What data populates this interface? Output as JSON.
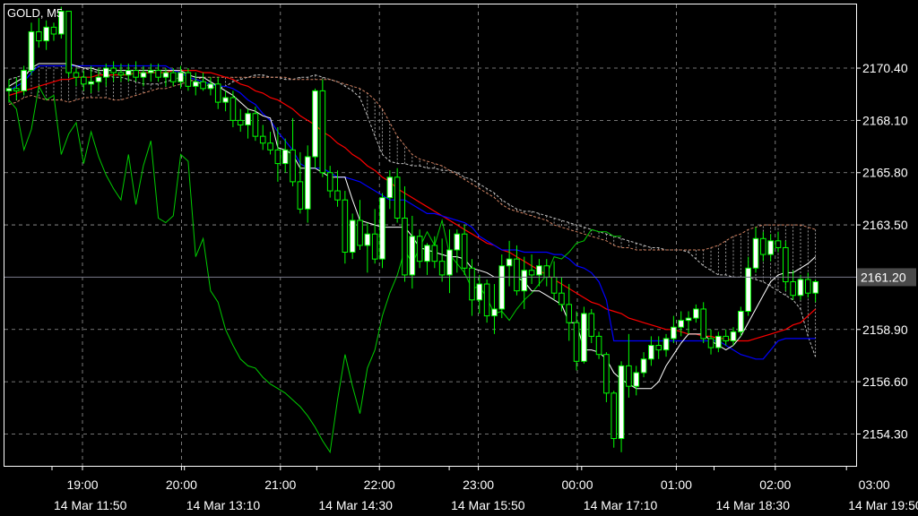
{
  "header": {
    "title": "GOLD, M5"
  },
  "chart_data": {
    "type": "candlestick",
    "symbol": "GOLD",
    "timeframe": "M5",
    "grid": true,
    "colors": {
      "background": "#000000",
      "grid": "#9a9a9a",
      "candle": "#00ff00",
      "bull_body": "#ffffff",
      "tenkan_sen": "#ffffff",
      "kijun_sen": "#0000ff",
      "moving_average": "#ff0000",
      "chikou_span": "#00cc00",
      "cloud_edge_a": "#c0c0c0",
      "cloud_edge_b": "#d08060",
      "current_price_line": "#7a7a8a",
      "price_tag_bg": "#4a4a4a"
    },
    "y_axis": {
      "min": 2152.9,
      "max": 2173.2,
      "ticks": [
        "2170.40",
        "2168.10",
        "2165.80",
        "2163.50",
        "2158.90",
        "2156.60",
        "2154.30"
      ]
    },
    "current_price": "2161.20",
    "x_axis": {
      "upper_labels": [
        "19:00",
        "20:00",
        "21:00",
        "22:00",
        "23:00",
        "00:00",
        "01:00",
        "02:00",
        "03:00"
      ],
      "lower_labels": [
        "14 Mar 11:50",
        "14 Mar 13:10",
        "14 Mar 14:30",
        "14 Mar 15:50",
        "14 Mar 17:10",
        "14 Mar 18:30",
        "14 Mar 19:50"
      ]
    },
    "candles_ohlc": [
      [
        2169.4,
        2169.9,
        2168.9,
        2169.5
      ],
      [
        2169.5,
        2170.0,
        2169.0,
        2169.4
      ],
      [
        2169.4,
        2170.5,
        2169.2,
        2170.3
      ],
      [
        2170.3,
        2172.4,
        2170.1,
        2172.0
      ],
      [
        2172.0,
        2172.6,
        2171.3,
        2171.6
      ],
      [
        2171.6,
        2172.5,
        2171.2,
        2172.2
      ],
      [
        2172.2,
        2172.4,
        2171.6,
        2171.9
      ],
      [
        2171.9,
        2173.1,
        2171.7,
        2172.9
      ],
      [
        2172.9,
        2172.9,
        2170.0,
        2170.2
      ],
      [
        2170.2,
        2170.4,
        2169.6,
        2170.0
      ],
      [
        2170.0,
        2170.3,
        2169.4,
        2169.7
      ],
      [
        2169.7,
        2170.5,
        2169.3,
        2169.8
      ],
      [
        2169.8,
        2170.4,
        2169.4,
        2170.0
      ],
      [
        2170.0,
        2170.6,
        2169.6,
        2170.4
      ],
      [
        2170.4,
        2170.7,
        2169.8,
        2170.2
      ],
      [
        2170.2,
        2170.6,
        2169.8,
        2170.1
      ],
      [
        2170.1,
        2170.6,
        2169.8,
        2170.3
      ],
      [
        2170.3,
        2170.7,
        2169.8,
        2170.0
      ],
      [
        2170.0,
        2170.5,
        2169.6,
        2170.2
      ],
      [
        2170.2,
        2170.6,
        2169.8,
        2170.3
      ],
      [
        2170.3,
        2170.6,
        2169.8,
        2170.0
      ],
      [
        2170.0,
        2170.4,
        2169.6,
        2170.2
      ],
      [
        2170.2,
        2170.4,
        2169.6,
        2169.8
      ],
      [
        2169.8,
        2170.5,
        2169.5,
        2170.2
      ],
      [
        2170.2,
        2170.4,
        2169.4,
        2169.6
      ],
      [
        2169.6,
        2170.2,
        2169.2,
        2169.8
      ],
      [
        2169.8,
        2170.2,
        2169.4,
        2169.5
      ],
      [
        2169.5,
        2170.0,
        2169.2,
        2169.7
      ],
      [
        2169.7,
        2170.0,
        2168.6,
        2168.9
      ],
      [
        2168.9,
        2169.4,
        2168.5,
        2169.1
      ],
      [
        2169.1,
        2169.4,
        2167.8,
        2168.1
      ],
      [
        2168.1,
        2168.6,
        2167.6,
        2167.9
      ],
      [
        2167.9,
        2168.6,
        2167.3,
        2168.4
      ],
      [
        2168.4,
        2168.7,
        2167.2,
        2167.4
      ],
      [
        2167.4,
        2167.9,
        2166.8,
        2167.1
      ],
      [
        2167.1,
        2167.6,
        2166.6,
        2166.8
      ],
      [
        2166.8,
        2167.8,
        2165.4,
        2166.2
      ],
      [
        2166.2,
        2167.3,
        2165.8,
        2166.8
      ],
      [
        2166.8,
        2168.2,
        2165.2,
        2165.4
      ],
      [
        2165.4,
        2166.7,
        2164.0,
        2164.2
      ],
      [
        2164.2,
        2167.0,
        2163.6,
        2166.5
      ],
      [
        2166.5,
        2169.5,
        2166.0,
        2169.4
      ],
      [
        2169.4,
        2169.9,
        2165.6,
        2165.8
      ],
      [
        2165.8,
        2166.1,
        2164.7,
        2165.0
      ],
      [
        2165.0,
        2165.9,
        2164.3,
        2164.6
      ],
      [
        2164.6,
        2165.0,
        2161.8,
        2162.3
      ],
      [
        2162.3,
        2164.0,
        2162.0,
        2163.7
      ],
      [
        2163.7,
        2164.6,
        2162.4,
        2162.6
      ],
      [
        2162.6,
        2163.6,
        2161.4,
        2163.1
      ],
      [
        2163.1,
        2164.2,
        2161.8,
        2162.0
      ],
      [
        2162.0,
        2164.9,
        2161.6,
        2164.7
      ],
      [
        2164.7,
        2165.9,
        2164.2,
        2165.6
      ],
      [
        2165.6,
        2166.0,
        2163.6,
        2163.8
      ],
      [
        2163.8,
        2165.2,
        2161.0,
        2161.3
      ],
      [
        2161.3,
        2163.9,
        2160.7,
        2163.0
      ],
      [
        2163.0,
        2163.3,
        2161.6,
        2161.9
      ],
      [
        2161.9,
        2162.7,
        2161.3,
        2162.6
      ],
      [
        2162.6,
        2163.0,
        2161.6,
        2161.9
      ],
      [
        2161.9,
        2162.9,
        2161.0,
        2161.3
      ],
      [
        2161.3,
        2163.3,
        2160.5,
        2162.4
      ],
      [
        2162.4,
        2163.3,
        2161.4,
        2163.1
      ],
      [
        2163.1,
        2163.5,
        2161.3,
        2161.6
      ],
      [
        2161.6,
        2162.0,
        2159.5,
        2160.2
      ],
      [
        2160.2,
        2161.3,
        2159.6,
        2160.9
      ],
      [
        2160.9,
        2161.1,
        2159.2,
        2159.5
      ],
      [
        2159.5,
        2160.9,
        2158.7,
        2159.8
      ],
      [
        2159.8,
        2162.2,
        2159.4,
        2161.7
      ],
      [
        2161.7,
        2162.8,
        2160.8,
        2162.0
      ],
      [
        2162.0,
        2162.6,
        2160.4,
        2160.6
      ],
      [
        2160.6,
        2162.1,
        2159.8,
        2161.5
      ],
      [
        2161.5,
        2162.2,
        2160.9,
        2161.3
      ],
      [
        2161.3,
        2162.0,
        2160.8,
        2161.7
      ],
      [
        2161.7,
        2162.0,
        2160.8,
        2161.2
      ],
      [
        2161.2,
        2161.9,
        2160.2,
        2160.5
      ],
      [
        2160.5,
        2161.2,
        2159.7,
        2160.0
      ],
      [
        2160.0,
        2160.9,
        2158.4,
        2159.2
      ],
      [
        2159.2,
        2159.7,
        2157.1,
        2157.5
      ],
      [
        2157.5,
        2159.9,
        2157.4,
        2159.6
      ],
      [
        2159.6,
        2159.8,
        2158.3,
        2158.6
      ],
      [
        2158.6,
        2158.8,
        2157.6,
        2157.8
      ],
      [
        2157.8,
        2157.9,
        2155.7,
        2156.1
      ],
      [
        2156.1,
        2156.2,
        2153.7,
        2154.1
      ],
      [
        2154.1,
        2157.5,
        2153.5,
        2157.3
      ],
      [
        2157.3,
        2158.7,
        2155.9,
        2156.4
      ],
      [
        2156.4,
        2157.3,
        2156.0,
        2157.0
      ],
      [
        2157.0,
        2157.9,
        2156.8,
        2157.6
      ],
      [
        2157.6,
        2158.6,
        2157.3,
        2158.2
      ],
      [
        2158.2,
        2158.6,
        2157.6,
        2158.0
      ],
      [
        2158.0,
        2158.7,
        2157.7,
        2158.5
      ],
      [
        2158.5,
        2159.5,
        2158.3,
        2159.0
      ],
      [
        2159.0,
        2159.7,
        2158.6,
        2159.3
      ],
      [
        2159.3,
        2159.7,
        2158.7,
        2159.4
      ],
      [
        2159.4,
        2160.0,
        2159.2,
        2159.8
      ],
      [
        2159.8,
        2160.1,
        2158.3,
        2158.5
      ],
      [
        2158.5,
        2158.9,
        2157.8,
        2158.1
      ],
      [
        2158.1,
        2158.8,
        2157.9,
        2158.6
      ],
      [
        2158.6,
        2158.9,
        2158.2,
        2158.4
      ],
      [
        2158.4,
        2159.0,
        2158.2,
        2158.8
      ],
      [
        2158.8,
        2159.9,
        2158.6,
        2159.7
      ],
      [
        2159.7,
        2162.1,
        2159.5,
        2161.6
      ],
      [
        2161.6,
        2163.4,
        2161.4,
        2162.9
      ],
      [
        2162.9,
        2163.2,
        2161.9,
        2162.2
      ],
      [
        2162.2,
        2163.1,
        2161.9,
        2162.8
      ],
      [
        2162.8,
        2163.2,
        2162.3,
        2162.5
      ],
      [
        2162.5,
        2162.8,
        2160.6,
        2161.0
      ],
      [
        2161.0,
        2161.5,
        2160.2,
        2160.4
      ],
      [
        2160.4,
        2161.3,
        2160.2,
        2161.1
      ],
      [
        2161.1,
        2161.4,
        2160.3,
        2160.5
      ],
      [
        2160.5,
        2161.1,
        2160.1,
        2161.0
      ]
    ],
    "tenkan_sen": [
      2169.6,
      2169.8,
      2170.0,
      2170.4,
      2170.6,
      2170.6,
      2170.6,
      2170.6,
      2170.6,
      2170.5,
      2170.4,
      2170.4,
      2170.3,
      2170.3,
      2170.3,
      2170.3,
      2170.3,
      2170.3,
      2170.3,
      2170.3,
      2170.3,
      2170.3,
      2170.3,
      2170.3,
      2170.1,
      2170.0,
      2170.0,
      2169.8,
      2169.6,
      2169.4,
      2169.2,
      2168.9,
      2168.6,
      2168.5,
      2168.3,
      2168.2,
      2166.9,
      2166.8,
      2166.6,
      2166.0,
      2166.0,
      2166.0,
      2165.8,
      2165.6,
      2165.6,
      2165.6,
      2164.6,
      2163.7,
      2163.6,
      2163.5,
      2163.4,
      2163.4,
      2163.4,
      2163.4,
      2163.0,
      2162.5,
      2162.4,
      2162.3,
      2162.2,
      2162.1,
      2162.1,
      2162.0,
      2161.6,
      2161.5,
      2161.4,
      2161.2,
      2161.2,
      2161.2,
      2161.2,
      2161.0,
      2160.6,
      2160.6,
      2160.4,
      2160.2,
      2160.0,
      2159.2,
      2159.2,
      2158.0,
      2158.0,
      2157.9,
      2157.6,
      2157.0,
      2156.7,
      2156.5,
      2156.3,
      2156.3,
      2156.3,
      2156.6,
      2157.3,
      2157.8,
      2158.3,
      2158.7,
      2158.7,
      2158.7,
      2158.4,
      2158.2,
      2158.0,
      2158.2,
      2158.6,
      2159.2,
      2159.8,
      2160.4,
      2161.0,
      2161.3,
      2161.4,
      2161.4,
      2161.6,
      2161.8,
      2162.1
    ],
    "kijun_sen": [
      2169.4,
      2169.6,
      2169.8,
      2170.2,
      2170.5,
      2170.5,
      2170.5,
      2170.5,
      2170.5,
      2170.5,
      2170.5,
      2170.5,
      2170.5,
      2170.5,
      2170.5,
      2170.5,
      2170.5,
      2170.5,
      2170.5,
      2170.5,
      2170.5,
      2170.5,
      2170.3,
      2170.2,
      2170.0,
      2169.9,
      2169.8,
      2169.7,
      2169.6,
      2169.6,
      2169.5,
      2169.3,
      2169.0,
      2168.8,
      2168.4,
      2168.1,
      2167.6,
      2167.2,
      2166.8,
      2166.2,
      2166.0,
      2166.0,
      2166.0,
      2165.8,
      2165.6,
      2165.6,
      2165.5,
      2165.4,
      2165.2,
      2165.0,
      2164.8,
      2164.6,
      2164.6,
      2164.6,
      2164.4,
      2164.2,
      2164.0,
      2164.0,
      2163.9,
      2163.8,
      2163.7,
      2163.6,
      2163.4,
      2163.0,
      2162.8,
      2162.6,
      2162.4,
      2162.4,
      2162.4,
      2162.3,
      2162.3,
      2162.3,
      2162.3,
      2162.2,
      2162.2,
      2162.0,
      2161.7,
      2161.6,
      2161.4,
      2161.0,
      2160.2,
      2158.4,
      2158.4,
      2158.4,
      2158.4,
      2158.4,
      2158.4,
      2158.4,
      2158.4,
      2158.4,
      2158.4,
      2158.4,
      2158.4,
      2158.4,
      2158.4,
      2158.4,
      2158.2,
      2158.0,
      2157.8,
      2157.7,
      2157.6,
      2157.6,
      2158.0,
      2158.4,
      2158.5,
      2158.5,
      2158.5,
      2158.5,
      2158.5
    ],
    "moving_average": [
      2169.2,
      2169.3,
      2169.4,
      2169.5,
      2169.6,
      2169.7,
      2169.8,
      2169.9,
      2169.9,
      2170.0,
      2170.0,
      2170.0,
      2170.1,
      2170.1,
      2170.1,
      2170.1,
      2170.1,
      2170.2,
      2170.2,
      2170.2,
      2170.2,
      2170.2,
      2170.3,
      2170.3,
      2170.3,
      2170.3,
      2170.2,
      2170.2,
      2170.1,
      2170.0,
      2169.9,
      2169.7,
      2169.6,
      2169.4,
      2169.3,
      2169.1,
      2169.0,
      2168.8,
      2168.6,
      2168.3,
      2168.1,
      2167.9,
      2167.6,
      2167.4,
      2167.1,
      2166.9,
      2166.6,
      2166.4,
      2166.1,
      2165.9,
      2165.6,
      2165.4,
      2165.1,
      2164.9,
      2164.7,
      2164.5,
      2164.3,
      2164.1,
      2163.9,
      2163.7,
      2163.5,
      2163.3,
      2163.1,
      2162.9,
      2162.7,
      2162.6,
      2162.4,
      2162.3,
      2162.1,
      2161.9,
      2161.7,
      2161.5,
      2161.3,
      2161.1,
      2160.9,
      2160.7,
      2160.5,
      2160.3,
      2160.1,
      2160.0,
      2159.8,
      2159.7,
      2159.6,
      2159.4,
      2159.3,
      2159.2,
      2159.1,
      2159.0,
      2158.9,
      2158.9,
      2158.8,
      2158.7,
      2158.7,
      2158.6,
      2158.6,
      2158.5,
      2158.5,
      2158.4,
      2158.4,
      2158.4,
      2158.5,
      2158.6,
      2158.7,
      2158.8,
      2158.9,
      2159.1,
      2159.2,
      2159.5,
      2159.8
    ],
    "chikou_span": [
      2169.0,
      2168.6,
      2166.8,
      2167.7,
      2169.6,
      2169.0,
      2169.2,
      2166.6,
      2167.5,
      2168.0,
      2166.2,
      2167.6,
      2166.5,
      2165.7,
      2165.1,
      2164.6,
      2166.6,
      2164.4,
      2166.1,
      2167.2,
      2163.8,
      2163.6,
      2163.9,
      2166.6,
      2166.3,
      2162.1,
      2162.9,
      2160.6,
      2160.1,
      2158.9,
      2158.2,
      2157.6,
      2157.3,
      2157.2,
      2156.8,
      2156.5,
      2156.3,
      2156.1,
      2155.8,
      2155.5,
      2155.1,
      2154.6,
      2154.0,
      2153.5,
      2155.8,
      2157.8,
      2156.4,
      2155.2,
      2157.2,
      2158.0,
      2159.5,
      2160.5,
      2161.3,
      2162.4,
      2161.8,
      2162.5,
      2163.2,
      2162.6,
      2163.7,
      2162.2,
      2161.8,
      2161.4,
      2160.7,
      2160.8,
      2160.3,
      2159.6,
      2159.7,
      2159.3,
      2159.8,
      2160.2,
      2160.5,
      2160.9,
      2161.3,
      2162.1,
      2162.0,
      2162.3,
      2162.7,
      2162.8,
      2163.3,
      2163.2,
      2163.2,
      2163.0,
      2163.0
    ],
    "cloud_span_a": [
      2169.9,
      2170.0,
      2170.1,
      2170.3,
      2170.5,
      2170.5,
      2170.5,
      2170.5,
      2170.5,
      2170.5,
      2170.4,
      2170.3,
      2170.2,
      2170.1,
      2170.0,
      2170.0,
      2169.9,
      2169.8,
      2169.7,
      2169.7,
      2169.7,
      2169.8,
      2169.9,
      2170.0,
      2169.9,
      2169.8,
      2169.7,
      2169.6,
      2169.5,
      2169.6,
      2169.8,
      2169.9,
      2170.0,
      2170.1,
      2170.1,
      2170.0,
      2170.0,
      2169.9,
      2169.9,
      2170.0,
      2170.0,
      2170.1,
      2170.0,
      2169.9,
      2169.8,
      2169.6,
      2169.4,
      2169.1,
      2168.3,
      2167.4,
      2166.6,
      2166.3,
      2166.2,
      2166.2,
      2166.1,
      2166.1,
      2166.0,
      2166.0,
      2165.9,
      2165.9,
      2165.8,
      2165.6,
      2165.5,
      2165.3,
      2165.1,
      2164.9,
      2164.6,
      2164.4,
      2164.2,
      2164.1,
      2164.1,
      2164.0,
      2163.9,
      2163.8,
      2163.7,
      2163.6,
      2163.5,
      2163.4,
      2163.3,
      2163.2,
      2163.1,
      2163.0,
      2162.9,
      2162.8,
      2162.7,
      2162.6,
      2162.5,
      2162.5,
      2162.4,
      2162.4,
      2162.4,
      2162.3,
      2162.0,
      2161.7,
      2161.5,
      2161.3,
      2161.3,
      2161.2,
      2161.2,
      2161.2,
      2161.1,
      2161.0,
      2160.8,
      2160.6,
      2160.4,
      2160.2,
      2159.8,
      2158.6,
      2157.7
    ],
    "cloud_span_b": [
      2168.8,
      2168.9,
      2169.1,
      2169.2,
      2169.1,
      2169.0,
      2169.0,
      2169.0,
      2168.9,
      2169.0,
      2169.1,
      2169.1,
      2169.1,
      2169.1,
      2169.0,
      2169.0,
      2169.1,
      2169.2,
      2169.3,
      2169.4,
      2169.5,
      2169.5,
      2169.6,
      2169.7,
      2169.8,
      2169.9,
      2170.0,
      2170.0,
      2170.0,
      2170.0,
      2170.0,
      2170.0,
      2170.0,
      2170.0,
      2170.0,
      2170.0,
      2170.0,
      2170.0,
      2169.9,
      2169.9,
      2169.9,
      2169.9,
      2169.9,
      2169.9,
      2169.8,
      2169.7,
      2169.6,
      2169.5,
      2169.3,
      2169.0,
      2168.6,
      2168.0,
      2167.4,
      2167.0,
      2166.6,
      2166.4,
      2166.3,
      2166.2,
      2166.1,
      2165.9,
      2165.7,
      2165.5,
      2165.3,
      2165.1,
      2164.9,
      2164.7,
      2164.4,
      2164.2,
      2164.1,
      2164.0,
      2163.9,
      2163.8,
      2163.7,
      2163.5,
      2163.4,
      2163.3,
      2163.2,
      2163.1,
      2163.0,
      2162.9,
      2162.8,
      2162.6,
      2162.5,
      2162.5,
      2162.4,
      2162.4,
      2162.4,
      2162.4,
      2162.4,
      2162.4,
      2162.4,
      2162.4,
      2162.4,
      2162.4,
      2162.5,
      2162.6,
      2162.8,
      2163.0,
      2163.1,
      2163.3,
      2163.4,
      2163.5,
      2163.5,
      2163.5,
      2163.5,
      2163.5,
      2163.5,
      2163.4,
      2163.3
    ]
  }
}
